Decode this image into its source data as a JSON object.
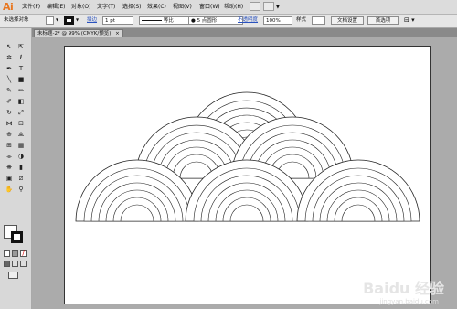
{
  "app": {
    "logo": "Ai"
  },
  "menubar": {
    "items": [
      "文件(F)",
      "编辑(E)",
      "对象(O)",
      "文字(T)",
      "选择(S)",
      "效果(C)",
      "视图(V)",
      "窗口(W)",
      "帮助(H)"
    ]
  },
  "control": {
    "selection_label": "未选择对象",
    "stroke_label": "描边",
    "stroke_weight": "1 pt",
    "brush_label": "等比",
    "point_label": "5 点圆形",
    "opacity_label": "不透明度",
    "opacity_value": "100%",
    "style_label": "样式",
    "doc_setup_button": "文档设置",
    "preferences_button": "首选项"
  },
  "document": {
    "tab_label": "未标题-2* @ 99% (CMYK/预览)",
    "close_glyph": "×"
  },
  "watermark": {
    "brand": "Baidu 经验",
    "url": "jingyan.baidu.com"
  }
}
